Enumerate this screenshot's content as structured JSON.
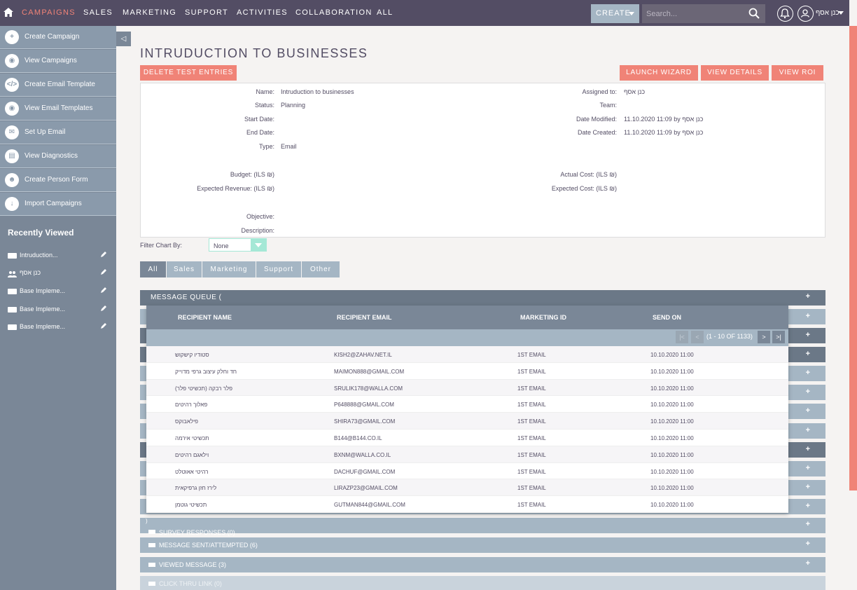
{
  "nav": {
    "items": [
      "CAMPAIGNS",
      "SALES",
      "MARKETING",
      "SUPPORT",
      "ACTIVITIES",
      "COLLABORATION",
      "ALL"
    ],
    "create": "CREATE",
    "search_placeholder": "Search...",
    "user": "כנן אסף"
  },
  "sidebar": {
    "actions": [
      "Create Campaign",
      "View Campaigns",
      "Create Email Template",
      "View Email Templates",
      "Set Up Email",
      "View Diagnostics",
      "Create Person Form",
      "Import Campaigns"
    ],
    "recently_viewed_title": "Recently Viewed",
    "recently_viewed": [
      "Intruduction...",
      "כנן אסף",
      "Base Impleme...",
      "Base Impleme...",
      "Base Impleme..."
    ]
  },
  "page": {
    "title": "INTRUDUCTION TO BUSINESSES",
    "buttons": {
      "delete": "DELETE TEST ENTRIES",
      "launch": "LAUNCH WIZARD",
      "details": "VIEW DETAILS",
      "roi": "VIEW ROI"
    }
  },
  "detail": {
    "name_label": "Name:",
    "name": "Intruduction to businesses",
    "status_label": "Status:",
    "status": "Planning",
    "start_label": "Start Date:",
    "end_label": "End Date:",
    "type_label": "Type:",
    "type": "Email",
    "budget_label": "Budget: (ILS ₪)",
    "exp_rev_label": "Expected Revenue: (ILS ₪)",
    "objective_label": "Objective:",
    "description_label": "Description:",
    "assigned_label": "Assigned to:",
    "assigned": "כנן אסף",
    "team_label": "Team:",
    "modified_label": "Date Modified:",
    "modified": "11.10.2020 11:09 by כנן אסף",
    "created_label": "Date Created:",
    "created": "11.10.2020 11:09 by כנן אסף",
    "actual_cost_label": "Actual Cost: (ILS ₪)",
    "expected_cost_label": "Expected Cost: (ILS ₪)"
  },
  "filter": {
    "label": "Filter Chart By:",
    "value": "None"
  },
  "tabs": [
    "All",
    "Sales",
    "Marketing",
    "Support",
    "Other"
  ],
  "subpanels": {
    "message_queue": "MESSAGE QUEUE (",
    "survey": "SURVEY RESPONSES (0)",
    "sent": "MESSAGE SENT/ATTEMPTED (6)",
    "viewed": "VIEWED MESSAGE (3)",
    "click": "CLICK THRU LINK (0)",
    "paren": ")"
  },
  "queue": {
    "headers": [
      "RECIPIENT NAME",
      "RECIPIENT EMAIL",
      "MARKETING ID",
      "SEND ON"
    ],
    "pager": "(1 - 10 OF 1133)",
    "rows": [
      [
        "סטודיו קישקוש",
        "KISH2@ZAHAV.NET.IL",
        "1ST EMAIL",
        "10.10.2020 11:00"
      ],
      [
        "חד וחלק עיצוב גרפי מדוייק",
        "MAIMON888@GMAIL.COM",
        "1ST EMAIL",
        "10.10.2020 11:00"
      ],
      [
        "פלר רבקה (תכשיטי פלר)",
        "SRULIK178@WALLA.COM",
        "1ST EMAIL",
        "10.10.2020 11:00"
      ],
      [
        "פאלוך רהיטים",
        "P648888@GMAIL.COM",
        "1ST EMAIL",
        "10.10.2020 11:00"
      ],
      [
        "פילאבוקס",
        "SHIRA73@GMAIL.COM",
        "1ST EMAIL",
        "10.10.2020 11:00"
      ],
      [
        "תכשיטי אירמה",
        "B144@B144.CO.IL",
        "1ST EMAIL",
        "10.10.2020 11:00"
      ],
      [
        "וילאגם רהיטים",
        "BXNM@WALLA.CO.IL",
        "1ST EMAIL",
        "10.10.2020 11:00"
      ],
      [
        "רהיטי אאוטלט",
        "DACHUF@GMAIL.COM",
        "1ST EMAIL",
        "10.10.2020 11:00"
      ],
      [
        "לירז חזן גרפיקאית",
        "LIRAZP23@GMAIL.COM",
        "1ST EMAIL",
        "10.10.2020 11:00"
      ],
      [
        "תכשיטי גוטמן",
        "GUTMAN844@GMAIL.COM",
        "1ST EMAIL",
        "10.10.2020 11:00"
      ]
    ]
  },
  "colors": {
    "accent": "#f08377",
    "nav": "#534d64",
    "sidebar": "#8a9aab",
    "panel": "#a5b6c4"
  }
}
